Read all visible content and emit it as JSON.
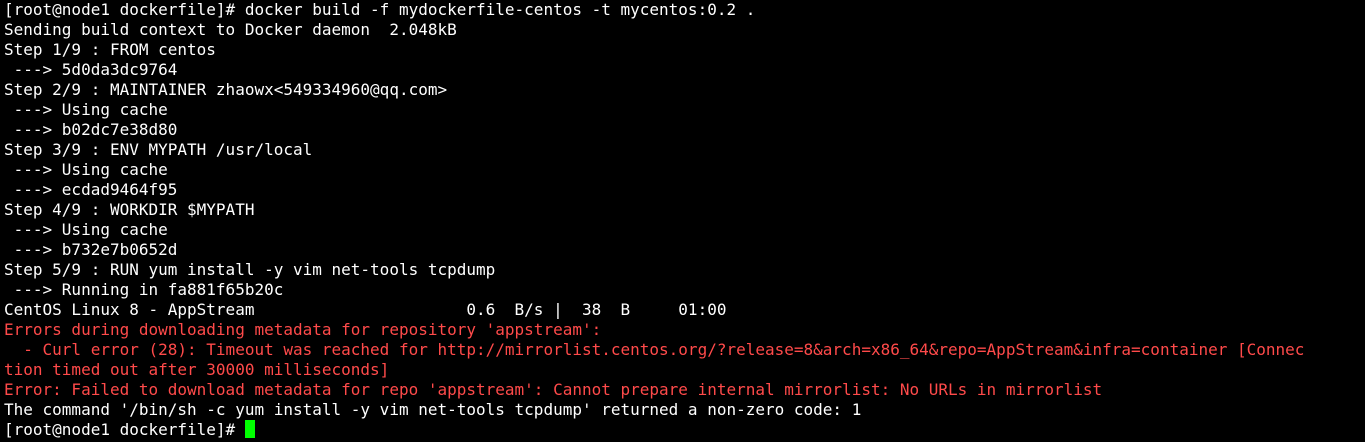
{
  "terminal": {
    "error_color": "#ff4a4a",
    "cursor_color": "#00ff00",
    "lines": [
      {
        "text": "[root@node1 dockerfile]# docker build -f mydockerfile-centos -t mycentos:0.2 .",
        "kind": "normal"
      },
      {
        "text": "Sending build context to Docker daemon  2.048kB",
        "kind": "normal"
      },
      {
        "text": "Step 1/9 : FROM centos",
        "kind": "normal"
      },
      {
        "text": " ---> 5d0da3dc9764",
        "kind": "normal"
      },
      {
        "text": "Step 2/9 : MAINTAINER zhaowx<549334960@qq.com>",
        "kind": "normal"
      },
      {
        "text": " ---> Using cache",
        "kind": "normal"
      },
      {
        "text": " ---> b02dc7e38d80",
        "kind": "normal"
      },
      {
        "text": "Step 3/9 : ENV MYPATH /usr/local",
        "kind": "normal"
      },
      {
        "text": " ---> Using cache",
        "kind": "normal"
      },
      {
        "text": " ---> ecdad9464f95",
        "kind": "normal"
      },
      {
        "text": "Step 4/9 : WORKDIR $MYPATH",
        "kind": "normal"
      },
      {
        "text": " ---> Using cache",
        "kind": "normal"
      },
      {
        "text": " ---> b732e7b0652d",
        "kind": "normal"
      },
      {
        "text": "Step 5/9 : RUN yum install -y vim net-tools tcpdump",
        "kind": "normal"
      },
      {
        "text": " ---> Running in fa881f65b20c",
        "kind": "normal"
      },
      {
        "text": "CentOS Linux 8 - AppStream                      0.6  B/s |  38  B     01:00",
        "kind": "normal"
      },
      {
        "text": "Errors during downloading metadata for repository 'appstream':",
        "kind": "err"
      },
      {
        "text": "  - Curl error (28): Timeout was reached for http://mirrorlist.centos.org/?release=8&arch=x86_64&repo=AppStream&infra=container [Connec",
        "kind": "err"
      },
      {
        "text": "tion timed out after 30000 milliseconds]",
        "kind": "err"
      },
      {
        "text": "Error: Failed to download metadata for repo 'appstream': Cannot prepare internal mirrorlist: No URLs in mirrorlist",
        "kind": "err"
      },
      {
        "text": "The command '/bin/sh -c yum install -y vim net-tools tcpdump' returned a non-zero code: 1",
        "kind": "normal"
      }
    ],
    "prompt": "[root@node1 dockerfile]# "
  }
}
